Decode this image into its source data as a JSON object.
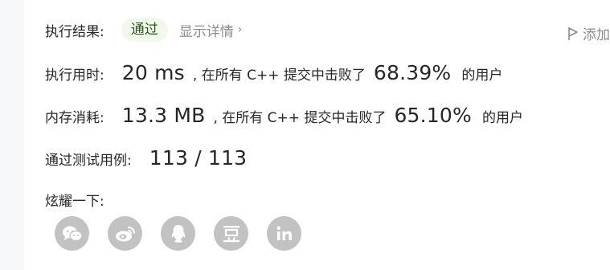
{
  "status": {
    "label": "执行结果:",
    "badge": "通过",
    "details": "显示详情",
    "add_note": "添加"
  },
  "runtime": {
    "label": "执行用时:",
    "value": "20 ms",
    "text": ", 在所有 C++ 提交中击败了",
    "percent": "68.39%",
    "suffix": "的用户"
  },
  "memory": {
    "label": "内存消耗:",
    "value": "13.3 MB",
    "text": ", 在所有 C++ 提交中击败了",
    "percent": "65.10%",
    "suffix": "的用户"
  },
  "testcases": {
    "label": "通过测试用例:",
    "value": "113 / 113"
  },
  "share": {
    "label": "炫耀一下:",
    "icons": [
      "wechat-icon",
      "weibo-icon",
      "qq-icon",
      "douban-icon",
      "linkedin-icon"
    ],
    "icon_bg": "#c2c2c2"
  }
}
